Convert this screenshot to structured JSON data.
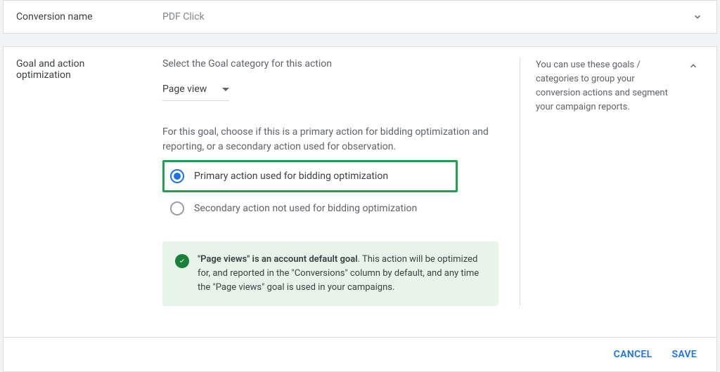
{
  "row1": {
    "label": "Conversion name",
    "value": "PDF Click"
  },
  "panel2": {
    "label_line1": "Goal and action",
    "label_line2": "optimization",
    "prompt": "Select the Goal category for this action",
    "select_value": "Page view",
    "helper": "For this goal, choose if this is a primary action for bidding optimization and reporting, or a secondary action used for observation.",
    "radio_primary": "Primary action used for bidding optimization",
    "radio_secondary": "Secondary action not used for bidding optimization",
    "notice_bold": "\"Page views\" is an account default goal",
    "notice_rest": ". This action will be optimized for, and reported in the \"Conversions\" column by default, and any time the \"Page views\" goal is used in your campaigns.",
    "aside": "You can use these goals / categories to group your conversion actions and segment your campaign reports."
  },
  "buttons": {
    "cancel": "CANCEL",
    "save": "SAVE"
  }
}
